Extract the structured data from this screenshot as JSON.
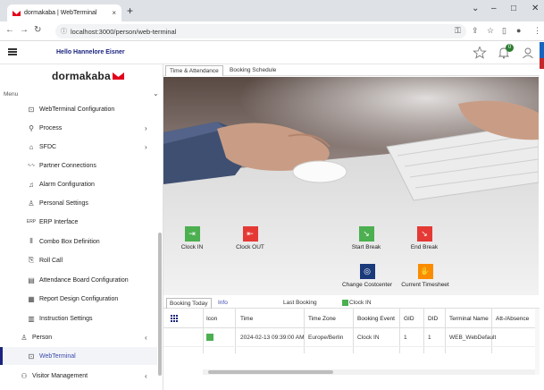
{
  "browser": {
    "tab_title": "dormakaba | WebTerminal",
    "tab_close": "×",
    "new_tab": "+",
    "url": "localhost:3000/person/web-terminal",
    "minimize": "–",
    "restore": "□",
    "close": "✕",
    "chevron": "⌄"
  },
  "header": {
    "greeting": "Hello Hannelore Eisner",
    "notification_count": "0"
  },
  "sidebar": {
    "logo": "dormakaba",
    "menu_label": "Menu",
    "items": [
      {
        "label": "WebTerminal Configuration",
        "icon": "terminal-config-icon"
      },
      {
        "label": "Process",
        "icon": "process-icon",
        "has_children": true
      },
      {
        "label": "SFDC",
        "icon": "sfdc-icon",
        "has_children": true
      },
      {
        "label": "Partner Connections",
        "icon": "partner-icon"
      },
      {
        "label": "Alarm Configuration",
        "icon": "alarm-icon"
      },
      {
        "label": "Personal Settings",
        "icon": "person-settings-icon"
      },
      {
        "label": "ERP Interface",
        "icon": "erp-icon"
      },
      {
        "label": "Combo Box Definition",
        "icon": "combo-icon"
      },
      {
        "label": "Roll Call",
        "icon": "rollcall-icon"
      },
      {
        "label": "Attendance Board Configuration",
        "icon": "attendance-board-icon"
      },
      {
        "label": "Report Design Configuration",
        "icon": "report-icon"
      },
      {
        "label": "Instruction Settings",
        "icon": "instruction-icon"
      },
      {
        "label": "Person",
        "icon": "person-icon",
        "has_children": true
      },
      {
        "label": "WebTerminal",
        "icon": "webterminal-icon",
        "active": true
      },
      {
        "label": "Visitor Management",
        "icon": "visitor-icon",
        "has_children": true
      }
    ]
  },
  "main": {
    "tabs": [
      "Time & Attendance",
      "Booking Schedule"
    ],
    "actions": [
      {
        "label": "Clock IN",
        "color": "#4caf50",
        "glyph": "⇥"
      },
      {
        "label": "Clock OUT",
        "color": "#e53935",
        "glyph": "⇤"
      },
      {
        "label": "Start Break",
        "color": "#4caf50",
        "glyph": "↘"
      },
      {
        "label": "End Break",
        "color": "#e53935",
        "glyph": "↘"
      },
      {
        "label": "Change Costcenter",
        "color": "#1a3a7a",
        "glyph": "◎"
      },
      {
        "label": "Current Timesheet",
        "color": "#fb8c00",
        "glyph": "✋"
      }
    ]
  },
  "booking": {
    "tabs": [
      "Booking Today",
      "Info"
    ],
    "last_booking_label": "Last Booking",
    "last_booking_value": "Clock IN",
    "columns": [
      "Icon",
      "Time",
      "Time Zone",
      "Booking Event",
      "GID",
      "DID",
      "Terminal Name",
      "Att-/Absence"
    ],
    "rows": [
      {
        "time": "2024-02-13 09:39:00 AM",
        "timezone": "Europe/Berlin",
        "event": "Clock IN",
        "gid": "1",
        "did": "1",
        "terminal": "WEB_WebDefault",
        "absence": ""
      }
    ]
  },
  "colors": {
    "brand_red": "#e3001b",
    "accent_navy": "#1a237e",
    "green": "#4caf50",
    "red": "#e53935"
  }
}
